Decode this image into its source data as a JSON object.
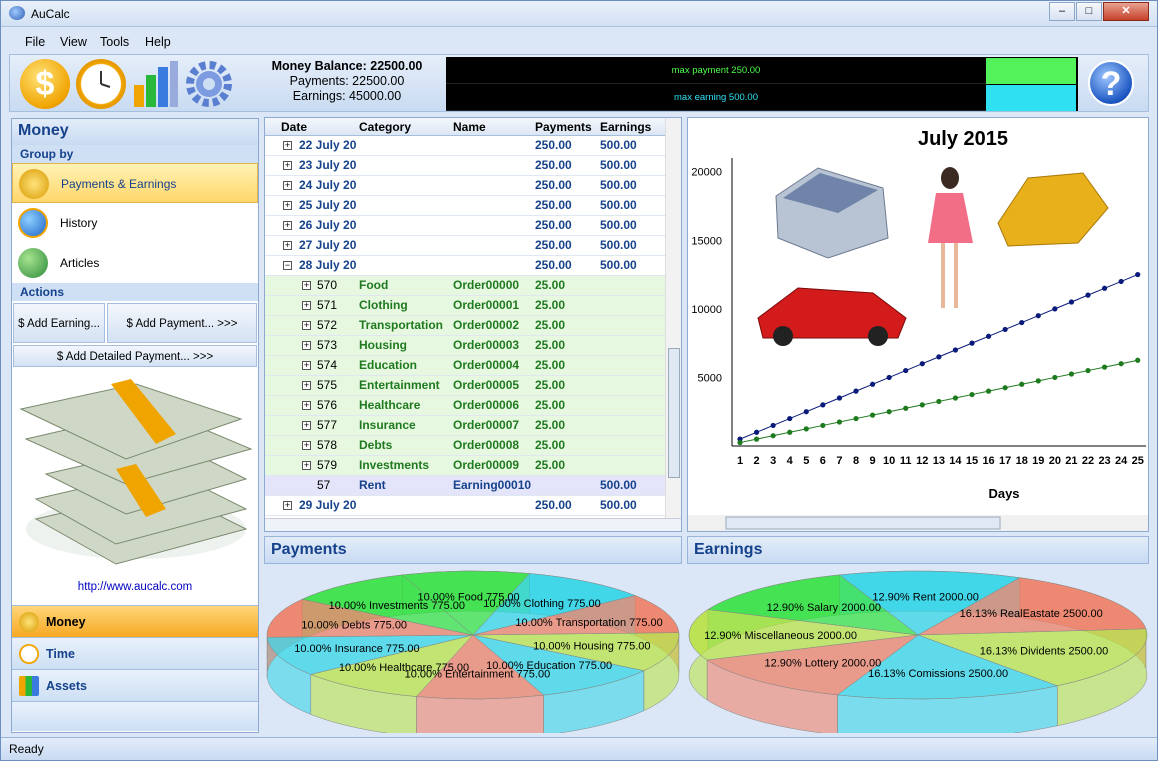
{
  "window": {
    "title": "AuCalc",
    "minimize": "–",
    "maximize": "□",
    "close": "✕"
  },
  "menu": {
    "file": "File",
    "view": "View",
    "tools": "Tools",
    "help": "Help"
  },
  "summary": {
    "balance": "Money Balance: 22500.00",
    "payments": "Payments: 22500.00",
    "earnings": "Earnings: 45000.00"
  },
  "strip": {
    "max_payment": "max payment 250.00",
    "max_earning": "max earning 500.00",
    "payment_color": "#54f25a",
    "earning_color": "#2fe0f2"
  },
  "left": {
    "title": "Money",
    "group_by": "Group by",
    "groups": [
      {
        "label": "Payments & Earnings",
        "icon": "coins-icon"
      },
      {
        "label": "History",
        "icon": "globe-icon"
      },
      {
        "label": "Articles",
        "icon": "globe-people-icon"
      }
    ],
    "actions_title": "Actions",
    "add_earning": "$ Add Earning...",
    "add_payment": "$ Add Payment... >>>",
    "add_detailed": "$ Add Detailed Payment... >>>",
    "url": "http://www.aucalc.com",
    "nav": [
      {
        "label": "Money",
        "icon": "coin-icon"
      },
      {
        "label": "Time",
        "icon": "clock-icon"
      },
      {
        "label": "Assets",
        "icon": "chart-icon"
      }
    ]
  },
  "grid": {
    "headers": {
      "date": "Date",
      "category": "Category",
      "name": "Name",
      "payments": "Payments",
      "earnings": "Earnings"
    },
    "rows": [
      {
        "type": "date",
        "date": "22 July 20",
        "payments": "250.00",
        "earnings": "500.00",
        "toggle": "+"
      },
      {
        "type": "date",
        "date": "23 July 20",
        "payments": "250.00",
        "earnings": "500.00",
        "toggle": "+"
      },
      {
        "type": "date",
        "date": "24 July 20",
        "payments": "250.00",
        "earnings": "500.00",
        "toggle": "+"
      },
      {
        "type": "date",
        "date": "25 July 20",
        "payments": "250.00",
        "earnings": "500.00",
        "toggle": "+"
      },
      {
        "type": "date",
        "date": "26 July 20",
        "payments": "250.00",
        "earnings": "500.00",
        "toggle": "+"
      },
      {
        "type": "date",
        "date": "27 July 20",
        "payments": "250.00",
        "earnings": "500.00",
        "toggle": "+"
      },
      {
        "type": "date",
        "date": "28 July 20",
        "payments": "250.00",
        "earnings": "500.00",
        "toggle": "−"
      },
      {
        "type": "pay",
        "id": "570",
        "category": "Food",
        "name": "Order00000",
        "payments": "25.00",
        "earnings": ""
      },
      {
        "type": "pay",
        "id": "571",
        "category": "Clothing",
        "name": "Order00001",
        "payments": "25.00",
        "earnings": ""
      },
      {
        "type": "pay",
        "id": "572",
        "category": "Transportation",
        "name": "Order00002",
        "payments": "25.00",
        "earnings": ""
      },
      {
        "type": "pay",
        "id": "573",
        "category": "Housing",
        "name": "Order00003",
        "payments": "25.00",
        "earnings": ""
      },
      {
        "type": "pay",
        "id": "574",
        "category": "Education",
        "name": "Order00004",
        "payments": "25.00",
        "earnings": ""
      },
      {
        "type": "pay",
        "id": "575",
        "category": "Entertainment",
        "name": "Order00005",
        "payments": "25.00",
        "earnings": ""
      },
      {
        "type": "pay",
        "id": "576",
        "category": "Healthcare",
        "name": "Order00006",
        "payments": "25.00",
        "earnings": ""
      },
      {
        "type": "pay",
        "id": "577",
        "category": "Insurance",
        "name": "Order00007",
        "payments": "25.00",
        "earnings": ""
      },
      {
        "type": "pay",
        "id": "578",
        "category": "Debts",
        "name": "Order00008",
        "payments": "25.00",
        "earnings": ""
      },
      {
        "type": "pay",
        "id": "579",
        "category": "Investments",
        "name": "Order00009",
        "payments": "25.00",
        "earnings": ""
      },
      {
        "type": "earn",
        "id": "57",
        "category": "Rent",
        "name": "Earning00010",
        "payments": "",
        "earnings": "500.00"
      },
      {
        "type": "date",
        "date": "29 July 20",
        "payments": "250.00",
        "earnings": "500.00",
        "toggle": "+"
      }
    ]
  },
  "chart_data": [
    {
      "type": "line",
      "title": "July 2015",
      "xlabel": "Days",
      "ylabel": "",
      "x": [
        1,
        2,
        3,
        4,
        5,
        6,
        7,
        8,
        9,
        10,
        11,
        12,
        13,
        14,
        15,
        16,
        17,
        18,
        19,
        20,
        21,
        22,
        23,
        24,
        25
      ],
      "yticks": [
        5000,
        10000,
        15000,
        20000
      ],
      "ylim": [
        0,
        21000
      ],
      "series": [
        {
          "name": "",
          "color": "#0a1a7a",
          "values": [
            500,
            1000,
            1500,
            2000,
            2500,
            3000,
            3500,
            4000,
            4500,
            5000,
            5500,
            6000,
            6500,
            7000,
            7500,
            8000,
            8500,
            9000,
            9500,
            10000,
            10500,
            11000,
            11500,
            12000,
            12500
          ]
        },
        {
          "name": "",
          "color": "#1d7a1d",
          "values": [
            250,
            500,
            750,
            1000,
            1250,
            1500,
            1750,
            2000,
            2250,
            2500,
            2750,
            3000,
            3250,
            3500,
            3750,
            4000,
            4250,
            4500,
            4750,
            5000,
            5250,
            5500,
            5750,
            6000,
            6250
          ]
        }
      ]
    },
    {
      "type": "pie",
      "title": "Payments",
      "labels": [
        "10.00% Food 775.00",
        "10.00% Clothing 775.00",
        "10.00% Transportation 775.00",
        "10.00% Housing 775.00",
        "10.00% Education 775.00",
        "10.00% Entertainment 775.00",
        "10.00% Healthcare 775.00",
        "10.00% Insurance 775.00",
        "10.00% Debts 775.00",
        "10.00% Investments 775.00"
      ],
      "values": [
        775,
        775,
        775,
        775,
        775,
        775,
        775,
        775,
        775,
        775
      ],
      "colors": [
        "#2ee23a",
        "#2ad4e6",
        "#f07a5e",
        "#b6e23a",
        "#2ad4e6",
        "#f07a5e",
        "#b6e23a",
        "#2ad4e6",
        "#f07a5e",
        "#2ee23a"
      ]
    },
    {
      "type": "pie",
      "title": "Earnings",
      "labels": [
        "12.90% Rent 2000.00",
        "16.13% RealEastate 2500.00",
        "16.13% Dividents 2500.00",
        "16.13% Comissions 2500.00",
        "12.90% Lottery 2000.00",
        "12.90% Miscellaneous 2000.00",
        "12.90% Salary 2000.00"
      ],
      "values": [
        2000,
        2500,
        2500,
        2500,
        2000,
        2000,
        2000
      ],
      "colors": [
        "#2ad4e6",
        "#f07a5e",
        "#b6e23a",
        "#2ad4e6",
        "#f07a5e",
        "#b6e23a",
        "#2ee23a"
      ]
    }
  ],
  "panes": {
    "payments": "Payments",
    "earnings": "Earnings"
  },
  "status": {
    "text": "Ready"
  }
}
